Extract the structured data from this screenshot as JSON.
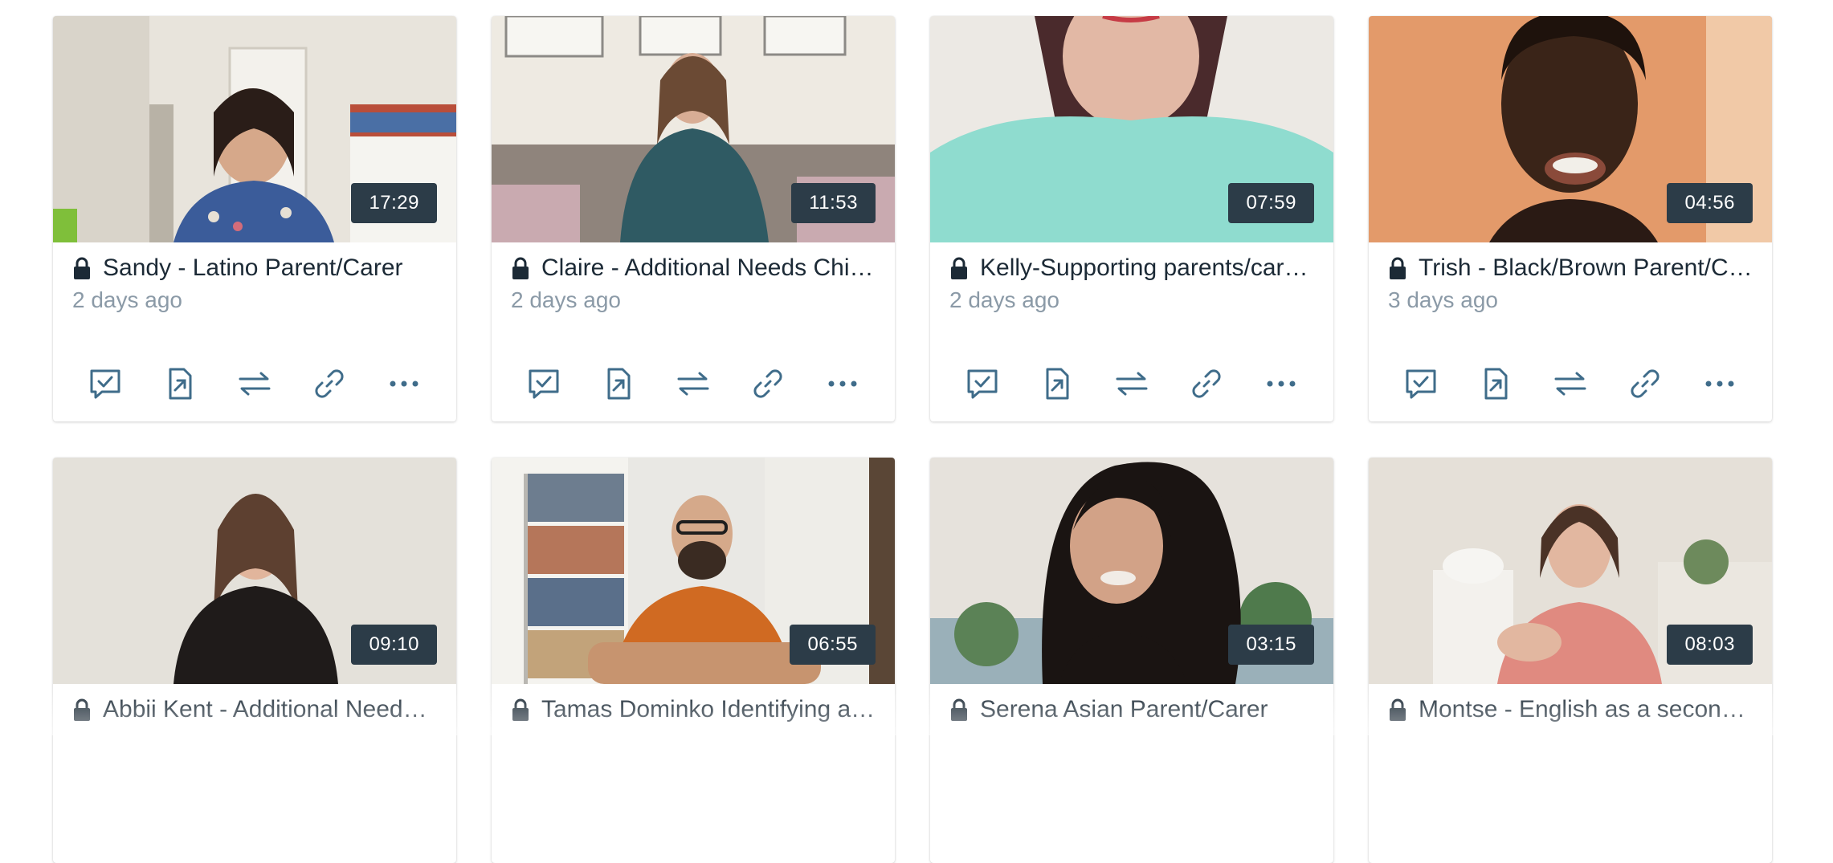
{
  "colors": {
    "accent_icon": "#3f6c8a",
    "title": "#1c2a36",
    "meta": "#8b9aa7",
    "duration_bg": "#2c3c48"
  },
  "icons": {
    "lock": "lock-icon",
    "actions": [
      "review-icon",
      "share-icon",
      "swap-icon",
      "link-icon",
      "more-icon"
    ]
  },
  "cards": [
    {
      "duration": "17:29",
      "title": "Sandy - Latino Parent/Carer",
      "age": "2 days ago"
    },
    {
      "duration": "11:53",
      "title": "Claire - Additional Needs Chi…",
      "age": "2 days ago"
    },
    {
      "duration": "07:59",
      "title": "Kelly-Supporting parents/car…",
      "age": "2 days ago"
    },
    {
      "duration": "04:56",
      "title": "Trish - Black/Brown Parent/C…",
      "age": "3 days ago"
    },
    {
      "duration": "09:10",
      "title": "Abbii Kent - Additional Need…",
      "age": ""
    },
    {
      "duration": "06:55",
      "title": "Tamas Dominko Identifying a…",
      "age": ""
    },
    {
      "duration": "03:15",
      "title": "Serena Asian Parent/Carer",
      "age": ""
    },
    {
      "duration": "08:03",
      "title": "Montse - English as a secon…",
      "age": ""
    }
  ]
}
